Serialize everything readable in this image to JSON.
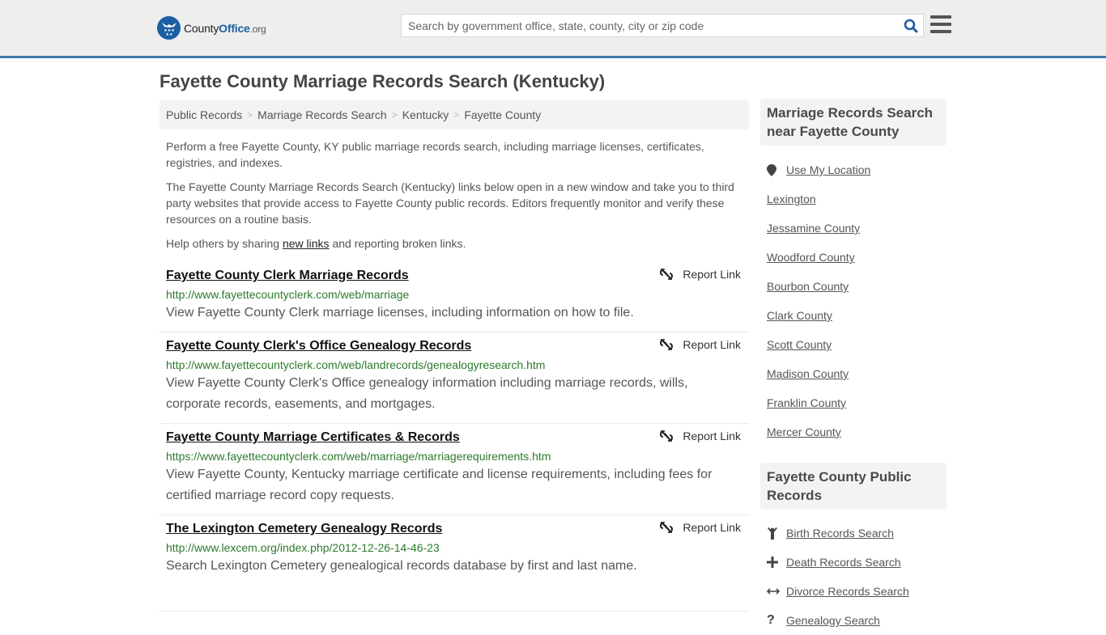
{
  "header": {
    "logo": {
      "county": "County",
      "office": "Office",
      "tld": ".org",
      "brand_color": "#1c5fa3"
    },
    "search": {
      "placeholder": "Search by government office, state, county, city or zip code",
      "value": ""
    },
    "accent_color": "#3a7cad"
  },
  "main": {
    "title": "Fayette County Marriage Records Search (Kentucky)",
    "breadcrumb": [
      {
        "label": "Public Records"
      },
      {
        "label": "Marriage Records Search"
      },
      {
        "label": "Kentucky"
      },
      {
        "label": "Fayette County"
      }
    ],
    "breadcrumb_separator": ">",
    "intro": {
      "p1": "Perform a free Fayette County, KY public marriage records search, including marriage licenses, certificates, registries, and indexes.",
      "p2": "The Fayette County Marriage Records Search (Kentucky) links below open in a new window and take you to third party websites that provide access to Fayette County public records. Editors frequently monitor and verify these resources on a routine basis.",
      "p3_before": "Help others by sharing ",
      "p3_link": "new links",
      "p3_after": " and reporting broken links."
    },
    "report_label": "Report Link",
    "results": [
      {
        "title": "Fayette County Clerk Marriage Records",
        "url": "http://www.fayettecountyclerk.com/web/marriage",
        "description": "View Fayette County Clerk marriage licenses, including information on how to file."
      },
      {
        "title": "Fayette County Clerk's Office Genealogy Records",
        "url": "http://www.fayettecountyclerk.com/web/landrecords/genealogyresearch.htm",
        "description": "View Fayette County Clerk's Office genealogy information including marriage records, wills, corporate records, easements, and mortgages."
      },
      {
        "title": "Fayette County Marriage Certificates & Records",
        "url": "https://www.fayettecountyclerk.com/web/marriage/marriagerequirements.htm",
        "description": "View Fayette County, Kentucky marriage certificate and license requirements, including fees for certified marriage record copy requests."
      },
      {
        "title": "The Lexington Cemetery Genealogy Records",
        "url": "http://www.lexcem.org/index.php/2012-12-26-14-46-23",
        "description": "Search Lexington Cemetery genealogical records database by first and last name."
      }
    ]
  },
  "sidebar": {
    "nearby": {
      "heading": "Marriage Records Search near Fayette County",
      "use_location": "Use My Location",
      "items": [
        "Lexington",
        "Jessamine County",
        "Woodford County",
        "Bourbon County",
        "Clark County",
        "Scott County",
        "Madison County",
        "Franklin County",
        "Mercer County"
      ]
    },
    "public_records": {
      "heading": "Fayette County Public Records",
      "items": [
        {
          "label": "Birth Records Search",
          "icon": "child-icon"
        },
        {
          "label": "Death Records Search",
          "icon": "plus-icon"
        },
        {
          "label": "Divorce Records Search",
          "icon": "arrows-horizontal-icon"
        },
        {
          "label": "Genealogy Search",
          "icon": "question-icon"
        }
      ]
    }
  }
}
